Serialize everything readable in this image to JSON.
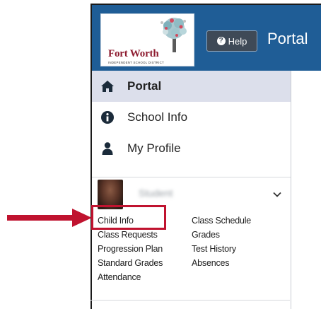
{
  "header": {
    "logo": {
      "name": "Fort Worth",
      "subtitle": "INDEPENDENT SCHOOL DISTRICT"
    },
    "help_label": "Help",
    "title": "Portal"
  },
  "sidebar": {
    "items": [
      {
        "label": "Portal",
        "icon": "home-icon",
        "active": true
      },
      {
        "label": "School Info",
        "icon": "info-circle-icon",
        "active": false
      },
      {
        "label": "My Profile",
        "icon": "user-icon",
        "active": false
      }
    ],
    "student": {
      "name": "Student",
      "expanded": true
    },
    "child_links": {
      "left": [
        "Child Info",
        "Class Requests",
        "Progression Plan",
        "Standard Grades",
        "Attendance"
      ],
      "right": [
        "Class Schedule",
        "Grades",
        "Test History",
        "Absences"
      ]
    }
  },
  "colors": {
    "header_bg": "#1f5d96",
    "active_bg": "#dcdfeb",
    "logo_red": "#8d1b2f",
    "highlight_red": "#c0132f"
  }
}
